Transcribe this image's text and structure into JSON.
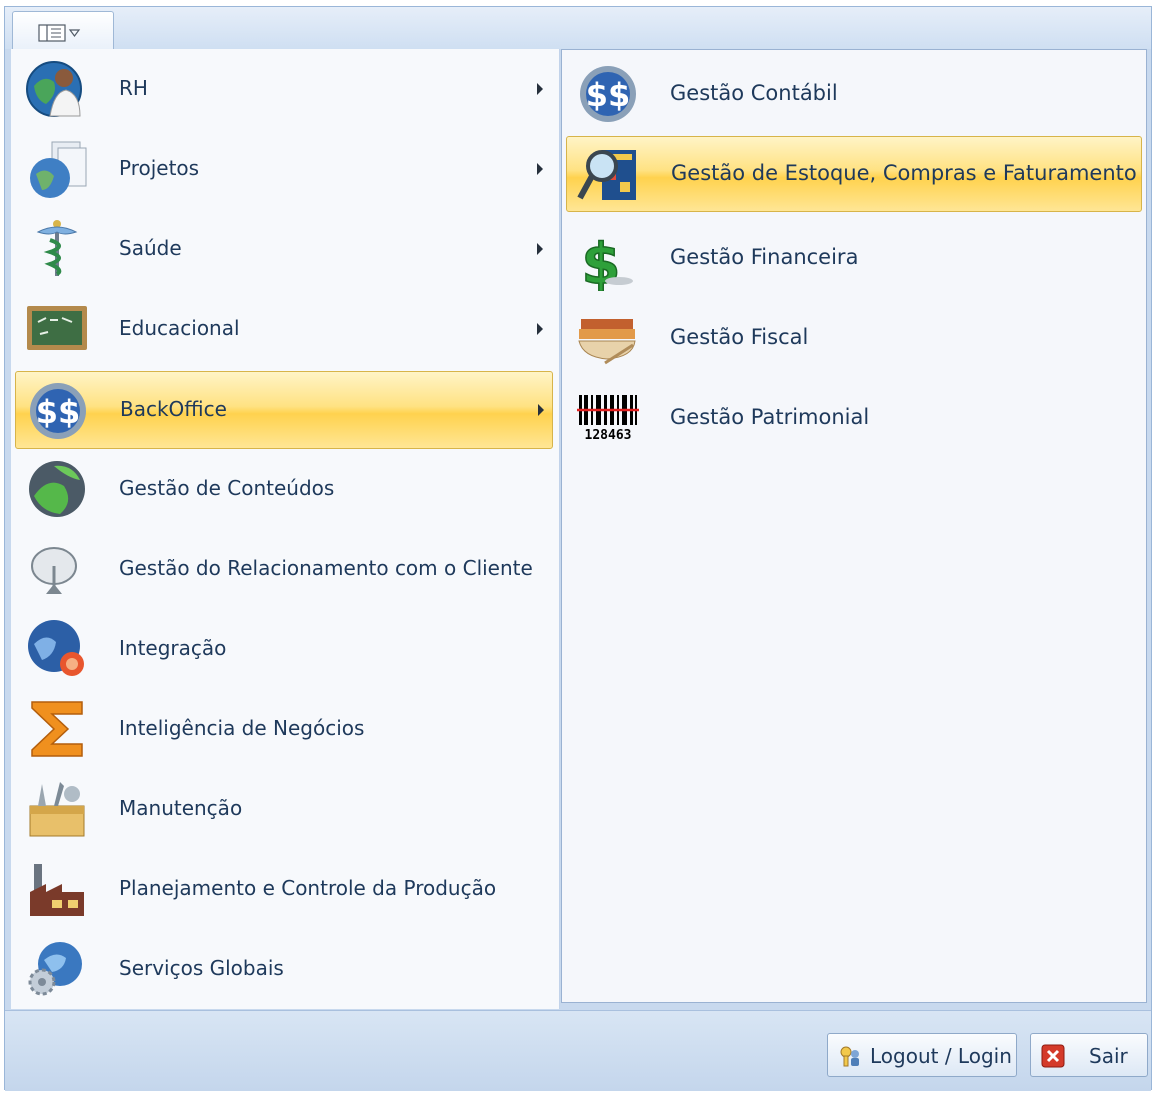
{
  "app_menu": {
    "button_icon": "ribbon-app-menu-icon",
    "left_items": [
      {
        "label": "RH",
        "icon": "hr-person-globe-icon",
        "has_submenu": true
      },
      {
        "label": "Projetos",
        "icon": "projects-globe-documents-icon",
        "has_submenu": true
      },
      {
        "label": "Saúde",
        "icon": "caduceus-icon",
        "has_submenu": true
      },
      {
        "label": "Educacional",
        "icon": "chalkboard-icon",
        "has_submenu": true
      },
      {
        "label": "BackOffice",
        "icon": "dollar-coin-icon",
        "has_submenu": true,
        "highlighted": true
      },
      {
        "label": "Gestão de Conteúdos",
        "icon": "green-globe-icon",
        "has_submenu": false
      },
      {
        "label": "Gestão do Relacionamento com o Cliente",
        "icon": "satellite-dish-icon",
        "has_submenu": false
      },
      {
        "label": "Integração",
        "icon": "globe-puzzle-icon",
        "has_submenu": false
      },
      {
        "label": "Inteligência de Negócios",
        "icon": "sigma-icon",
        "has_submenu": false
      },
      {
        "label": "Manutenção",
        "icon": "toolbox-icon",
        "has_submenu": false
      },
      {
        "label": "Planejamento e Controle da Produção",
        "icon": "factory-icon",
        "has_submenu": false
      },
      {
        "label": "Serviços Globais",
        "icon": "globe-gears-icon",
        "has_submenu": false
      }
    ],
    "right_items": [
      {
        "label": "Gestão Contábil",
        "icon": "dollar-coin-icon"
      },
      {
        "label": "Gestão de Estoque, Compras e Faturamento",
        "icon": "magnifier-document-icon",
        "highlighted": true
      },
      {
        "label": "Gestão Financeira",
        "icon": "green-dollar-icon"
      },
      {
        "label": "Gestão Fiscal",
        "icon": "books-quill-icon"
      },
      {
        "label": "Gestão Patrimonial",
        "icon": "barcode-icon",
        "barcode_text": "128463"
      }
    ]
  },
  "footer": {
    "logout_label": "Logout / Login",
    "logout_icon": "keys-users-icon",
    "exit_label": "Sair",
    "exit_icon": "red-close-icon"
  },
  "colors": {
    "highlight": "#ffd24e",
    "text": "#1e395b",
    "frame": "#c8d9ee"
  }
}
